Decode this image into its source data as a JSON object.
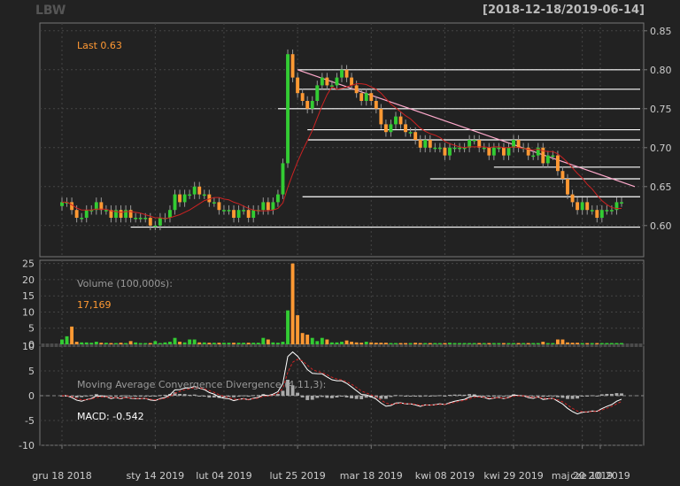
{
  "header": {
    "symbol": "LBW",
    "date_range": "[2018-12-18/2019-06-14]"
  },
  "colors": {
    "up": "#33cc33",
    "down": "#ff9933",
    "ma": "#cc2222",
    "trend": "#ffaacc",
    "hline": "#ffffff",
    "macd": "#ffffff",
    "signal": "#cc2222",
    "hist": "#aaaaaa",
    "label_orange": "#ff9933",
    "text": "#cccccc",
    "grid": "#444444",
    "border": "#777777"
  },
  "price_panel": {
    "last_label": "Last 0.63",
    "yticks": [
      "0.85",
      "0.80",
      "0.75",
      "0.70",
      "0.65",
      "0.60"
    ]
  },
  "volume_panel": {
    "title": "Volume (100,000s):",
    "value": "17,169",
    "yticks": [
      "25",
      "20",
      "15",
      "10",
      "5",
      "0"
    ]
  },
  "macd_panel": {
    "title": "Moving Average Convergence Divergence (4,11,3):",
    "value_label": "MACD: -0.542",
    "yticks": [
      "10",
      "5",
      "0",
      "-5",
      "-10"
    ]
  },
  "xaxis": {
    "labels": [
      "gru 18 2018",
      "sty 14 2019",
      "lut 04 2019",
      "lut 25 2019",
      "mar 18 2019",
      "kwi 08 2019",
      "kwi 29 2019",
      "maj 20 2019",
      "cze 10 2019"
    ]
  },
  "chart_data": [
    {
      "type": "candlestick",
      "title": "LBW",
      "subtitle": "[2018-12-18/2019-06-14]",
      "ylim": [
        0.56,
        0.86
      ],
      "last": 0.63,
      "close": [
        0.63,
        0.63,
        0.62,
        0.61,
        0.61,
        0.62,
        0.62,
        0.63,
        0.62,
        0.62,
        0.61,
        0.62,
        0.61,
        0.62,
        0.61,
        0.61,
        0.61,
        0.61,
        0.6,
        0.6,
        0.61,
        0.61,
        0.62,
        0.64,
        0.63,
        0.64,
        0.64,
        0.65,
        0.64,
        0.64,
        0.63,
        0.63,
        0.62,
        0.62,
        0.62,
        0.61,
        0.62,
        0.62,
        0.61,
        0.62,
        0.62,
        0.63,
        0.62,
        0.63,
        0.64,
        0.68,
        0.82,
        0.79,
        0.77,
        0.76,
        0.75,
        0.76,
        0.78,
        0.79,
        0.78,
        0.78,
        0.79,
        0.8,
        0.79,
        0.78,
        0.77,
        0.76,
        0.77,
        0.76,
        0.75,
        0.73,
        0.72,
        0.73,
        0.74,
        0.73,
        0.72,
        0.72,
        0.71,
        0.7,
        0.71,
        0.7,
        0.7,
        0.7,
        0.69,
        0.7,
        0.7,
        0.7,
        0.7,
        0.71,
        0.71,
        0.7,
        0.7,
        0.69,
        0.7,
        0.7,
        0.69,
        0.7,
        0.71,
        0.7,
        0.7,
        0.69,
        0.69,
        0.7,
        0.68,
        0.69,
        0.69,
        0.67,
        0.66,
        0.64,
        0.63,
        0.62,
        0.63,
        0.62,
        0.62,
        0.61,
        0.62,
        0.62,
        0.62,
        0.63,
        0.63
      ],
      "volume_100k": [
        1.5,
        2.5,
        5.5,
        0.8,
        0.6,
        0.6,
        0.5,
        0.8,
        0.5,
        0.5,
        0.4,
        0.4,
        0.5,
        0.4,
        1.0,
        0.6,
        0.4,
        0.4,
        0.4,
        1.0,
        0.4,
        0.6,
        0.8,
        2.0,
        0.8,
        0.6,
        1.5,
        1.5,
        0.6,
        0.6,
        0.5,
        0.5,
        0.5,
        0.5,
        0.5,
        0.5,
        0.5,
        0.5,
        0.5,
        0.5,
        0.5,
        2.0,
        1.5,
        0.6,
        0.5,
        0.8,
        10.5,
        25.0,
        9.0,
        3.5,
        3.0,
        2.0,
        1.0,
        2.0,
        1.5,
        0.6,
        0.6,
        0.8,
        1.2,
        0.8,
        0.6,
        0.5,
        0.8,
        0.6,
        0.5,
        0.5,
        0.5,
        0.4,
        0.4,
        0.4,
        0.4,
        0.4,
        0.5,
        0.4,
        0.4,
        0.4,
        0.4,
        0.4,
        0.4,
        0.5,
        0.4,
        0.4,
        0.4,
        0.4,
        0.4,
        0.4,
        0.4,
        0.4,
        0.4,
        0.4,
        0.4,
        0.4,
        0.4,
        0.4,
        0.4,
        0.4,
        0.4,
        0.4,
        0.8,
        0.4,
        0.4,
        1.5,
        1.5,
        0.6,
        0.5,
        0.5,
        0.4,
        0.4,
        0.4,
        0.4,
        0.4,
        0.4,
        0.4,
        0.4,
        0.4
      ],
      "hlines": [
        0.8,
        0.775,
        0.75,
        0.723,
        0.71,
        0.675,
        0.66,
        0.637,
        0.598
      ],
      "trendline": {
        "from": {
          "index": 53,
          "value": 0.8
        },
        "to": {
          "index": 117,
          "value": 0.65
        }
      },
      "ma_period": 10
    },
    {
      "type": "bar",
      "title": "Volume (100,000s):",
      "last_value": "17,169",
      "ylim": [
        0,
        26
      ]
    },
    {
      "type": "line",
      "title": "Moving Average Convergence Divergence (4,11,3):",
      "value_label": "MACD: -0.542",
      "ylim": [
        -10,
        10
      ]
    }
  ]
}
